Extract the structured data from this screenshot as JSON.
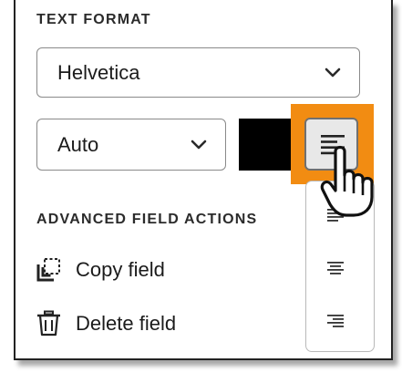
{
  "text_format": {
    "title": "TEXT FORMAT",
    "font_value": "Helvetica",
    "size_value": "Auto",
    "color": "#000000",
    "highlight_color": "#f28c12"
  },
  "advanced": {
    "title": "ADVANCED FIELD ACTIONS",
    "copy_label": "Copy field",
    "delete_label": "Delete field"
  },
  "align_menu": {
    "options": [
      "align-left",
      "align-center",
      "align-right"
    ]
  }
}
